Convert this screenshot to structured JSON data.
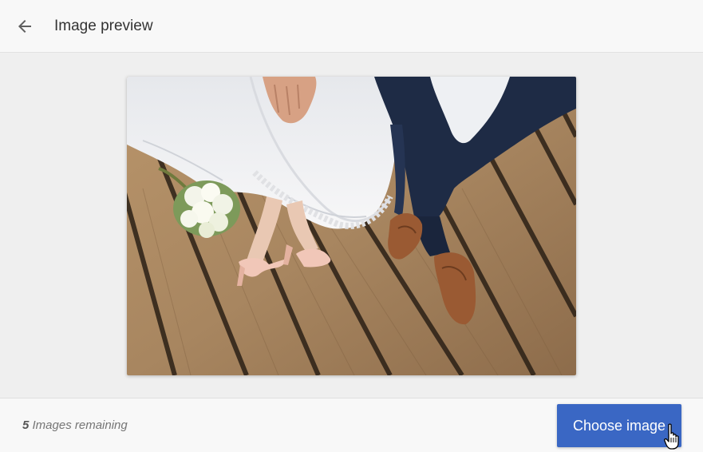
{
  "header": {
    "back_icon": "arrow-left-icon",
    "title": "Image preview"
  },
  "preview": {
    "image_icon": "wedding-photo",
    "colors": {
      "wood": "#a88660",
      "dress": "#f2f2f4",
      "suit": "#1e2b45",
      "shoes": "#9a5a33"
    }
  },
  "footer": {
    "remaining_count": "5",
    "remaining_label": " Images remaining",
    "choose_label": "Choose image",
    "accent": "#3a67c4"
  }
}
